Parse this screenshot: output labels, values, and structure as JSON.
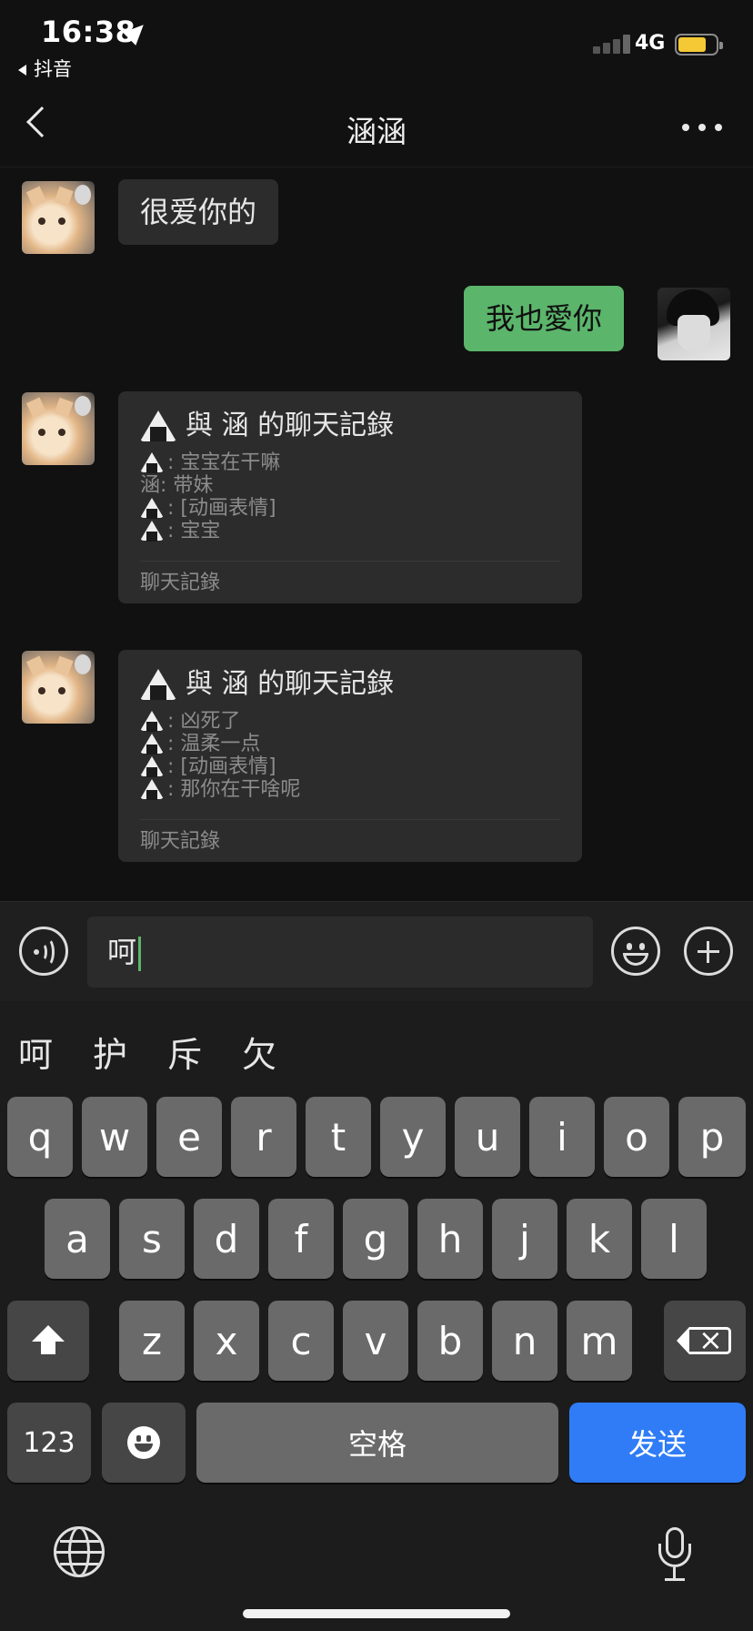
{
  "status_bar": {
    "time": "16:38",
    "back_app": "抖音",
    "network": "4G",
    "battery_level": 0.65,
    "battery_color": "#f5c936"
  },
  "nav": {
    "title": "涵涵",
    "back_icon": "chevron-left-icon",
    "more_icon": "more-dots-icon"
  },
  "messages": [
    {
      "side": "in",
      "text": "很爱你的"
    },
    {
      "side": "out",
      "text": "我也愛你"
    }
  ],
  "cards": [
    {
      "title": "與 涵 的聊天記錄",
      "lines": [
        {
          "icon": true,
          "text": ": 宝宝在干嘛"
        },
        {
          "icon": false,
          "text": "涵: 带妹"
        },
        {
          "icon": true,
          "text": ": [动画表情]"
        },
        {
          "icon": true,
          "text": ": 宝宝"
        }
      ],
      "footer": "聊天記錄"
    },
    {
      "title": "與 涵 的聊天記錄",
      "lines": [
        {
          "icon": true,
          "text": ": 凶死了"
        },
        {
          "icon": true,
          "text": ": 温柔一点"
        },
        {
          "icon": true,
          "text": ": [动画表情]"
        },
        {
          "icon": true,
          "text": ": 那你在干啥呢"
        }
      ],
      "footer": "聊天記錄"
    }
  ],
  "input": {
    "value": "呵",
    "caret_color": "#5bb56b"
  },
  "keyboard": {
    "candidates": [
      "呵",
      "护",
      "斥",
      "欠"
    ],
    "row1": [
      "q",
      "w",
      "e",
      "r",
      "t",
      "y",
      "u",
      "i",
      "o",
      "p"
    ],
    "row2": [
      "a",
      "s",
      "d",
      "f",
      "g",
      "h",
      "j",
      "k",
      "l"
    ],
    "row3": [
      "z",
      "x",
      "c",
      "v",
      "b",
      "n",
      "m"
    ],
    "num_key": "123",
    "space_key": "空格",
    "send_key": "发送",
    "send_color": "#2f7cf6"
  },
  "colors": {
    "background": "#111111",
    "bubble_in": "#2c2c2c",
    "bubble_out": "#5bb56b"
  }
}
